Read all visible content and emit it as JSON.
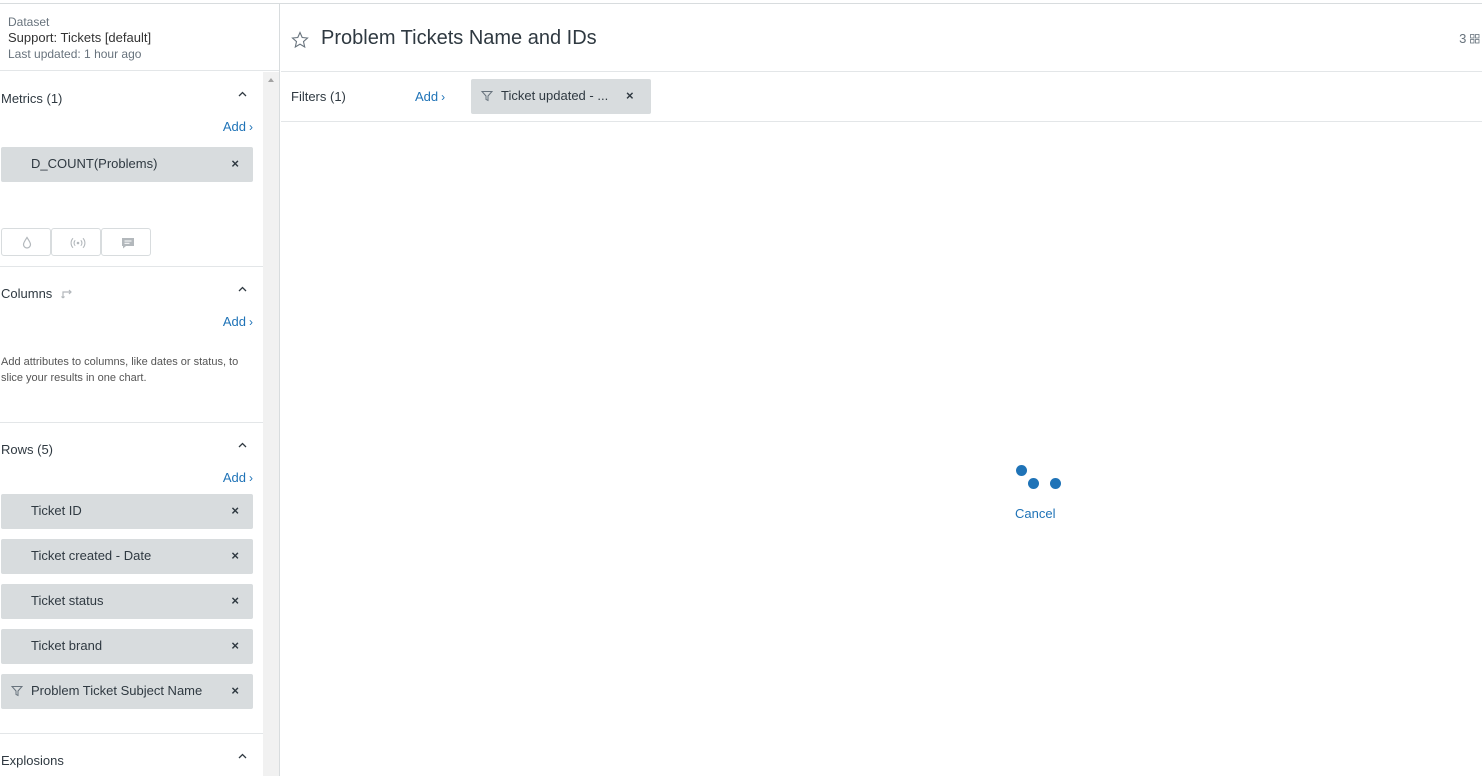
{
  "dataset": {
    "label": "Dataset",
    "name": "Support: Tickets [default]",
    "updated": "Last updated: 1 hour ago"
  },
  "metrics": {
    "title": "Metrics (1)",
    "add": "Add",
    "items": [
      "D_COUNT(Problems)"
    ]
  },
  "viz_buttons": [
    "drop-icon",
    "broadcast-icon",
    "comment-icon"
  ],
  "columns": {
    "title": "Columns",
    "add": "Add",
    "help": "Add attributes to columns, like dates or status, to slice your results in one chart."
  },
  "rows": {
    "title": "Rows (5)",
    "add": "Add",
    "items": [
      {
        "label": "Ticket ID",
        "filtered": false
      },
      {
        "label": "Ticket created - Date",
        "filtered": false
      },
      {
        "label": "Ticket status",
        "filtered": false
      },
      {
        "label": "Ticket brand",
        "filtered": false
      },
      {
        "label": "Problem Ticket Subject Name",
        "filtered": true
      }
    ]
  },
  "explosions": {
    "title": "Explosions"
  },
  "report": {
    "title": "Problem Tickets Name and IDs",
    "count": "3"
  },
  "filters": {
    "title": "Filters (1)",
    "add": "Add",
    "items": [
      "Ticket updated - ..."
    ]
  },
  "loading": {
    "cancel": "Cancel"
  },
  "colors": {
    "accent": "#1f73b7",
    "pill": "#d8dcde",
    "text": "#2f3941"
  }
}
